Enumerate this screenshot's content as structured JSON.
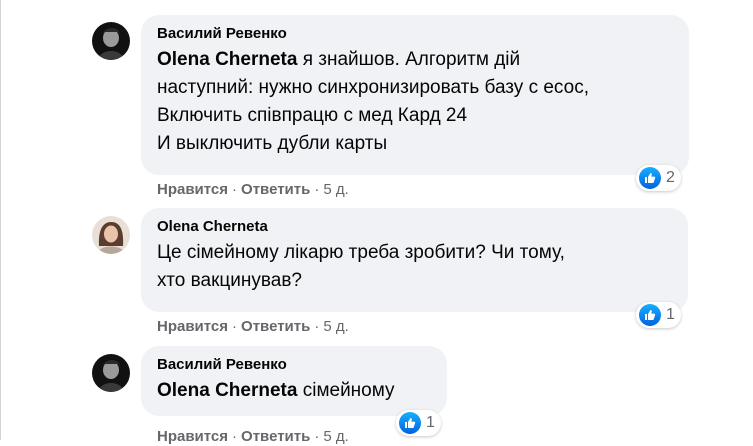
{
  "comments": [
    {
      "author": "Василий Ревенко",
      "mention": "Olena Cherneta",
      "text_line1": " я знайшов. Алгоритм дій",
      "text_line2": "наступний: нужно синхронизировать базу с есос,",
      "text_line3": "Включить співпрацю с мед Кард 24",
      "text_line4": "И выключить дубли карты",
      "likes": "2",
      "like_label": "Нравится",
      "reply_label": "Ответить",
      "time": "5 д."
    },
    {
      "author": "Olena Cherneta",
      "text_line1": "Це сімейному лікарю треба зробити? Чи тому,",
      "text_line2": "хто вакцинував?",
      "likes": "1",
      "like_label": "Нравится",
      "reply_label": "Ответить",
      "time": "5 д."
    },
    {
      "author": "Василий Ревенко",
      "mention": "Olena Cherneta",
      "text_line1": " сімейному",
      "likes": "1",
      "like_label": "Нравится",
      "reply_label": "Ответить",
      "time": "5 д."
    }
  ],
  "separator": "·",
  "colors": {
    "bubble": "#f0f2f5",
    "secondary_text": "#65676b",
    "like_blue": "#0a7cff"
  },
  "icons": {
    "like": "thumbs-up-icon"
  }
}
